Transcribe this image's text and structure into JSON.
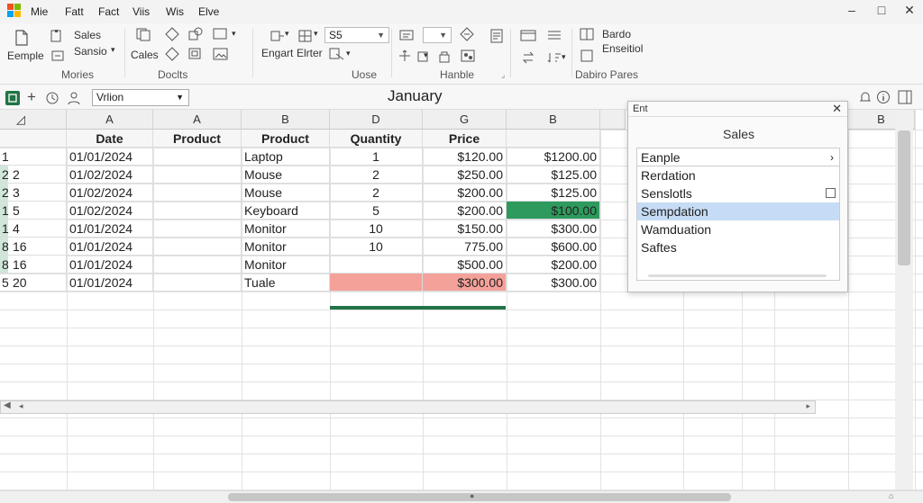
{
  "menu": [
    "Mie",
    "Fatt",
    "Fact",
    "Viis",
    "Wis",
    "Elve"
  ],
  "window": {
    "minimize": "–",
    "restore": "□",
    "close": "✕"
  },
  "ribbon": {
    "left_top": "Sales",
    "left_mid": "Sansio",
    "left_bottom": "Eemple",
    "cales": "Cales",
    "ss_combo": "S5",
    "engart": "Engart",
    "elrter": "Elrter",
    "bardo": "Bardo",
    "enseitiol": "Enseitiol",
    "groups": [
      "Mories",
      "Doclts",
      "Uose",
      "Hanble",
      "Dabiro Pares"
    ]
  },
  "formula_bar": {
    "name_box": "Vrlion",
    "title": "January"
  },
  "columns": [
    "A",
    "A",
    "B",
    "D",
    "G",
    "B",
    "B"
  ],
  "headers": [
    "Date",
    "Product",
    "Product",
    "Quantity",
    "Price",
    ""
  ],
  "row_numbers": [
    [
      "1",
      ""
    ],
    [
      "2",
      "2"
    ],
    [
      "2",
      "3"
    ],
    [
      "1",
      "5"
    ],
    [
      "1",
      "4"
    ],
    [
      "8",
      "16"
    ],
    [
      "8",
      "16"
    ],
    [
      "5",
      "20"
    ]
  ],
  "rows": [
    [
      "01/01/2024",
      "",
      "Laptop",
      "1",
      "$120.00",
      "$1200.00"
    ],
    [
      "01/02/2024",
      "",
      "Mouse",
      "2",
      "$250.00",
      "$125.00"
    ],
    [
      "01/02/2024",
      "",
      "Mouse",
      "2",
      "$200.00",
      "$125.00"
    ],
    [
      "01/02/2024",
      "",
      "Keyboard",
      "5",
      "$200.00",
      "$100.00"
    ],
    [
      "01/01/2024",
      "",
      "Monitor",
      "10",
      "$150.00",
      "$300.00"
    ],
    [
      "01/01/2024",
      "",
      "Monitor",
      "10",
      "775.00",
      "$600.00"
    ],
    [
      "01/01/2024",
      "",
      "Monitor",
      "",
      "$500.00",
      "$200.00"
    ],
    [
      "01/01/2024",
      "",
      "Tuale",
      "",
      "$300.00",
      "$300.00"
    ]
  ],
  "highlights": {
    "green": "#2e9a5e",
    "red": "#f4a19a"
  },
  "dialog": {
    "title": "Ent",
    "heading": "Sales",
    "items": [
      "Eanple",
      "Rerdation",
      "Senslotls",
      "Sempdation",
      "Wamduation",
      "Saftes"
    ]
  }
}
